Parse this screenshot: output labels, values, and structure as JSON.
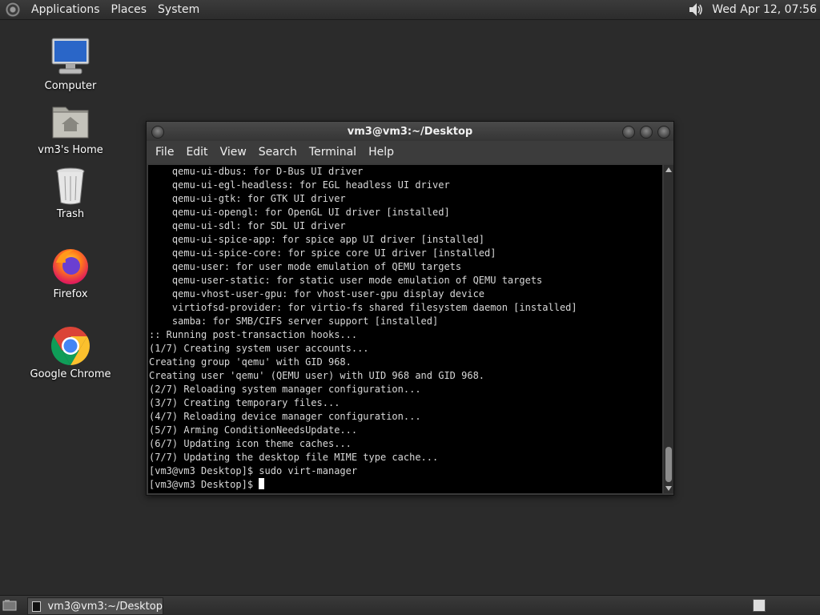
{
  "top_panel": {
    "menus": [
      "Applications",
      "Places",
      "System"
    ],
    "clock": "Wed Apr 12, 07:56",
    "icons": {
      "menu": "gnome-foot-icon",
      "volume": "volume-icon"
    }
  },
  "desktop": {
    "icons": [
      {
        "label": "Computer",
        "icon": "computer-icon"
      },
      {
        "label": "vm3's Home",
        "icon": "home-folder-icon"
      },
      {
        "label": "Trash",
        "icon": "trash-icon"
      },
      {
        "label": "Firefox",
        "icon": "firefox-icon"
      },
      {
        "label": "Google Chrome",
        "icon": "chrome-icon"
      }
    ]
  },
  "terminal": {
    "title": "vm3@vm3:~/Desktop",
    "menus": [
      "File",
      "Edit",
      "View",
      "Search",
      "Terminal",
      "Help"
    ],
    "lines": [
      "    qemu-ui-dbus: for D-Bus UI driver",
      "    qemu-ui-egl-headless: for EGL headless UI driver",
      "    qemu-ui-gtk: for GTK UI driver",
      "    qemu-ui-opengl: for OpenGL UI driver [installed]",
      "    qemu-ui-sdl: for SDL UI driver",
      "    qemu-ui-spice-app: for spice app UI driver [installed]",
      "    qemu-ui-spice-core: for spice core UI driver [installed]",
      "    qemu-user: for user mode emulation of QEMU targets",
      "    qemu-user-static: for static user mode emulation of QEMU targets",
      "    qemu-vhost-user-gpu: for vhost-user-gpu display device",
      "    virtiofsd-provider: for virtio-fs shared filesystem daemon [installed]",
      "    samba: for SMB/CIFS server support [installed]",
      ":: Running post-transaction hooks...",
      "(1/7) Creating system user accounts...",
      "Creating group 'qemu' with GID 968.",
      "Creating user 'qemu' (QEMU user) with UID 968 and GID 968.",
      "(2/7) Reloading system manager configuration...",
      "(3/7) Creating temporary files...",
      "(4/7) Reloading device manager configuration...",
      "(5/7) Arming ConditionNeedsUpdate...",
      "(6/7) Updating icon theme caches...",
      "(7/7) Updating the desktop file MIME type cache...",
      "[vm3@vm3 Desktop]$ sudo virt-manager"
    ],
    "prompt": "[vm3@vm3 Desktop]$ "
  },
  "bottom_panel": {
    "task": "vm3@vm3:~/Desktop",
    "icons": {
      "show_desktop": "show-desktop-icon",
      "task": "terminal-icon",
      "workspace": "workspace-switcher-icon"
    }
  }
}
